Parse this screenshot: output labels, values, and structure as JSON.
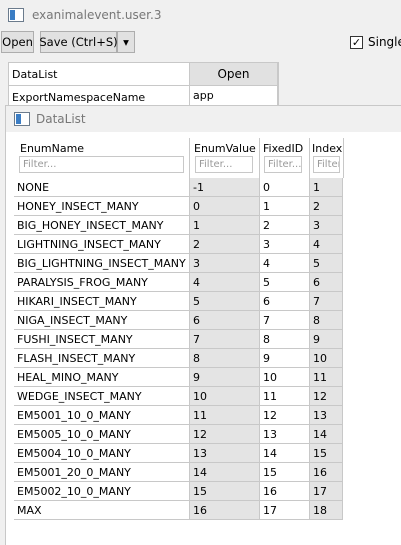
{
  "window": {
    "title": "exanimalevent.user.3"
  },
  "toolbar": {
    "open_label": "Open",
    "save_label": "Save (Ctrl+S)",
    "dropdown_glyph": "▾",
    "single_label": "Single",
    "single_checked": "✓"
  },
  "props": {
    "datalist_label": "DataList",
    "open_label": "Open",
    "namespace_label": "ExportNamespaceName",
    "namespace_value": "app"
  },
  "sub": {
    "title": "DataList",
    "columns": [
      {
        "header": "EnumName",
        "filter": "Filter..."
      },
      {
        "header": "EnumValue",
        "filter": "Filter..."
      },
      {
        "header": "FixedID",
        "filter": "Filter..."
      },
      {
        "header": "Index",
        "filter": "Filter..."
      }
    ],
    "rows": [
      [
        "NONE",
        "-1",
        "0",
        "1"
      ],
      [
        "HONEY_INSECT_MANY",
        "0",
        "1",
        "2"
      ],
      [
        "BIG_HONEY_INSECT_MANY",
        "1",
        "2",
        "3"
      ],
      [
        "LIGHTNING_INSECT_MANY",
        "2",
        "3",
        "4"
      ],
      [
        "BIG_LIGHTNING_INSECT_MANY",
        "3",
        "4",
        "5"
      ],
      [
        "PARALYSIS_FROG_MANY",
        "4",
        "5",
        "6"
      ],
      [
        "HIKARI_INSECT_MANY",
        "5",
        "6",
        "7"
      ],
      [
        "NIGA_INSECT_MANY",
        "6",
        "7",
        "8"
      ],
      [
        "FUSHI_INSECT_MANY",
        "7",
        "8",
        "9"
      ],
      [
        "FLASH_INSECT_MANY",
        "8",
        "9",
        "10"
      ],
      [
        "HEAL_MINO_MANY",
        "9",
        "10",
        "11"
      ],
      [
        "WEDGE_INSECT_MANY",
        "10",
        "11",
        "12"
      ],
      [
        "EM5001_10_0_MANY",
        "11",
        "12",
        "13"
      ],
      [
        "EM5005_10_0_MANY",
        "12",
        "13",
        "14"
      ],
      [
        "EM5004_10_0_MANY",
        "13",
        "14",
        "15"
      ],
      [
        "EM5001_20_0_MANY",
        "14",
        "15",
        "16"
      ],
      [
        "EM5002_10_0_MANY",
        "15",
        "16",
        "17"
      ],
      [
        "MAX",
        "16",
        "17",
        "18"
      ]
    ]
  }
}
